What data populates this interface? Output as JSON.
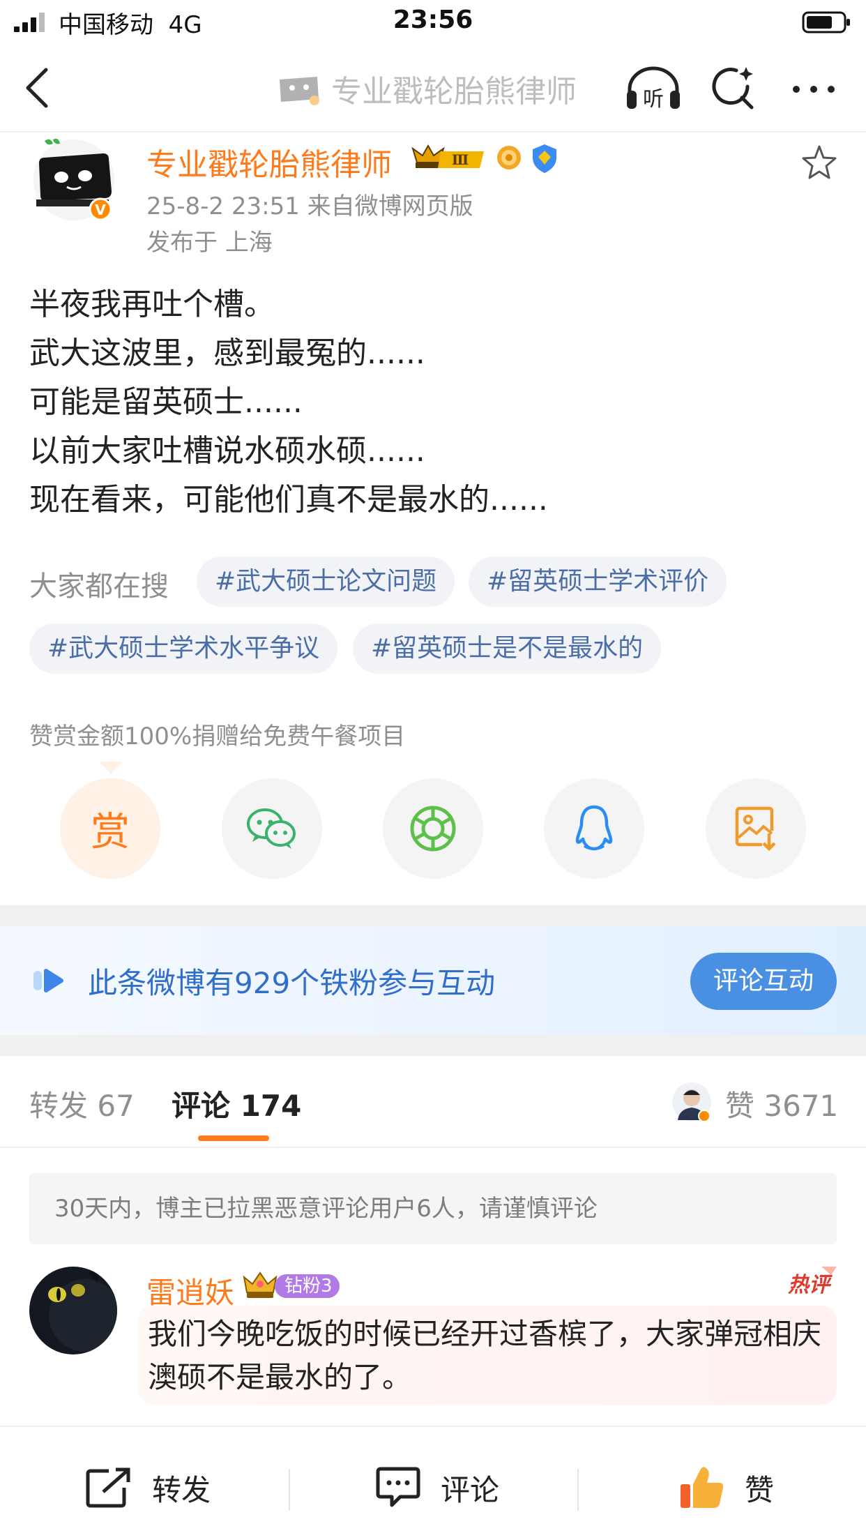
{
  "status_bar": {
    "carrier": "中国移动",
    "network": "4G",
    "time": "23:56"
  },
  "nav": {
    "title": "专业戳轮胎熊律师",
    "listen_label": "听"
  },
  "post": {
    "author": "专业戳轮胎熊律师",
    "level_badge": "Ⅲ",
    "meta": "25-8-2 23:51  来自微博网页版",
    "location": "发布于 上海",
    "lines": [
      "半夜我再吐个槽。",
      "武大这波里，感到最冤的......",
      "可能是留英硕士......",
      "以前大家吐槽说水硕水硕......",
      "现在看来，可能他们真不是最水的......"
    ]
  },
  "search": {
    "label": "大家都在搜",
    "tags": [
      "#武大硕士论文问题",
      "#留英硕士学术评价",
      "#武大硕士学术水平争议",
      "#留英硕士是不是最水的"
    ]
  },
  "reward": {
    "note": "赞赏金额100%捐赠给免费午餐项目",
    "button_label": "赏"
  },
  "share_icons": [
    "reward-icon",
    "wechat-icon",
    "moments-icon",
    "qq-icon",
    "save-image-icon"
  ],
  "fans_banner": {
    "text": "此条微博有929个铁粉参与互动",
    "button": "评论互动"
  },
  "tabs": {
    "repost": "转发 67",
    "comment": "评论 174",
    "like": "赞 3671"
  },
  "notice": "30天内，博主已拉黑恶意评论用户6人，请谨慎评论",
  "comment": {
    "user": "雷逍妖",
    "badge": "钻粉3",
    "hot_label": "热评",
    "text": "我们今晚吃饭的时候已经开过香槟了，大家弹冠相庆澳硕不是最水的了。"
  },
  "bottom_bar": {
    "repost": "转发",
    "comment": "评论",
    "like": "赞"
  },
  "colors": {
    "accent_orange": "#ff7a1a",
    "link_blue": "#4b6ea7",
    "fans_blue": "#4a90e2",
    "vip_purple": "#b27ae6"
  }
}
